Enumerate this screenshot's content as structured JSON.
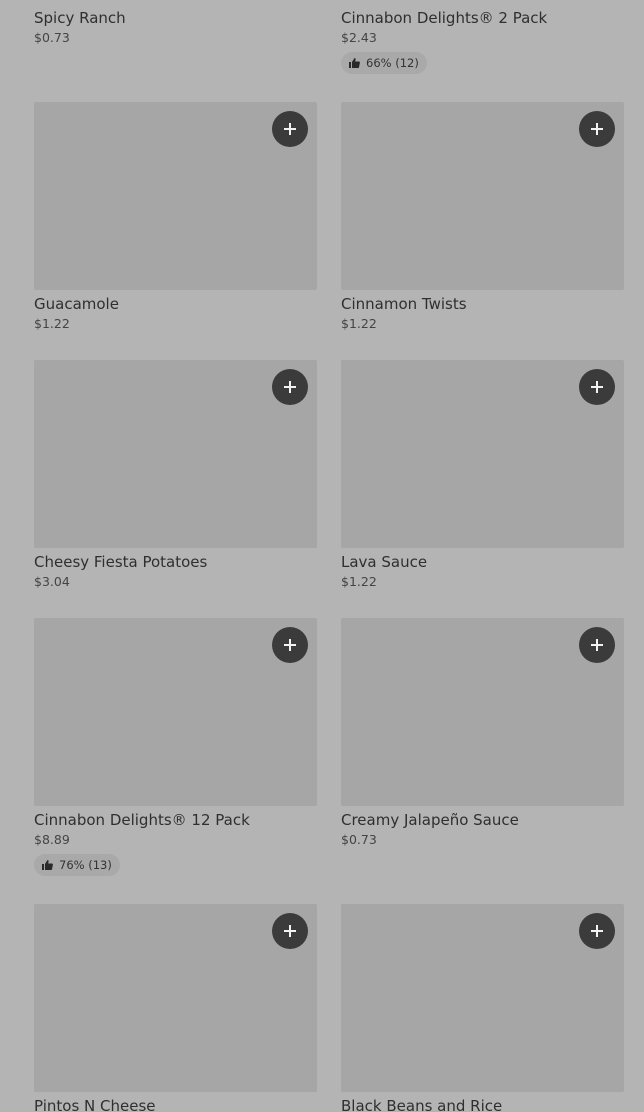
{
  "items": [
    {
      "name": "Spicy Ranch",
      "price": "$0.73",
      "rating": ""
    },
    {
      "name": "Cinnabon Delights® 2 Pack",
      "price": "$2.43",
      "rating": "66% (12)"
    },
    {
      "name": "Guacamole",
      "price": "$1.22",
      "rating": ""
    },
    {
      "name": "Cinnamon Twists",
      "price": "$1.22",
      "rating": ""
    },
    {
      "name": "Cheesy Fiesta Potatoes",
      "price": "$3.04",
      "rating": ""
    },
    {
      "name": "Lava Sauce",
      "price": "$1.22",
      "rating": ""
    },
    {
      "name": "Cinnabon Delights® 12 Pack",
      "price": "$8.89",
      "rating": "76% (13)"
    },
    {
      "name": "Creamy Jalapeño Sauce",
      "price": "$0.73",
      "rating": ""
    },
    {
      "name": "Pintos N Cheese",
      "price": "",
      "rating": ""
    },
    {
      "name": "Black Beans and Rice",
      "price": "",
      "rating": ""
    }
  ],
  "icons": {
    "add": "plus-icon",
    "rating": "thumbs-up-icon"
  },
  "colors": {
    "background": "#b4b4b4",
    "image_placeholder": "#a6a6a6",
    "add_button": "#3b3b3b"
  }
}
